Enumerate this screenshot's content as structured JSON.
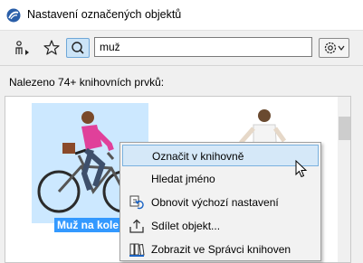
{
  "window": {
    "title": "Nastavení označených objektů"
  },
  "toolbar": {
    "search_value": "muž"
  },
  "results": {
    "found_label": "Nalezeno 74+ knihovních prvků:"
  },
  "items": [
    {
      "label": "Muž na kole 24"
    }
  ],
  "context_menu": {
    "items": [
      {
        "label": "Označit v knihovně",
        "icon": "none",
        "highlighted": true
      },
      {
        "label": "Hledat jméno",
        "icon": "none"
      },
      {
        "label": "Obnovit výchozí nastavení",
        "icon": "reset-icon"
      },
      {
        "label": "Sdílet objekt...",
        "icon": "share-icon"
      },
      {
        "label": "Zobrazit ve Správci knihoven",
        "icon": "library-manager-icon"
      }
    ]
  },
  "colors": {
    "selection": "#3399ff",
    "thumb_selected": "#cce8ff",
    "menu_highlight": "#d5e8f8"
  }
}
